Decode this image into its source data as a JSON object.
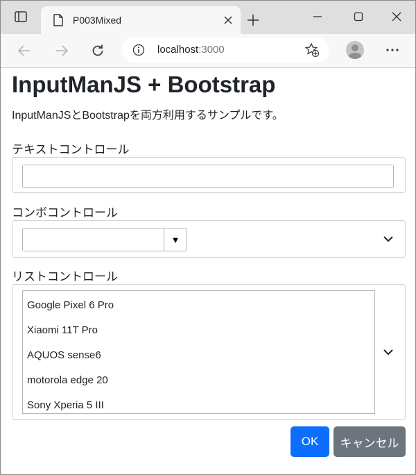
{
  "browser": {
    "tab_title": "P003Mixed",
    "url_host": "localhost",
    "url_port": ":3000"
  },
  "page": {
    "title": "InputManJS + Bootstrap",
    "description": "InputManJSとBootstrapを両方利用するサンプルです。",
    "text_control": {
      "label": "テキストコントロール",
      "value": ""
    },
    "combo_control": {
      "label": "コンボコントロール",
      "value": "",
      "dropdown_glyph": "▼"
    },
    "list_control": {
      "label": "リストコントロール",
      "items": [
        "Google Pixel 6 Pro",
        "Xiaomi 11T Pro",
        "AQUOS sense6",
        "motorola edge 20",
        "Sony Xperia 5 III"
      ]
    },
    "buttons": {
      "ok": "OK",
      "cancel": "キャンセル"
    }
  },
  "colors": {
    "primary": "#0d6efd",
    "secondary": "#6c757d",
    "border": "#ced4da"
  },
  "icons": [
    "sidebar-toggle-icon",
    "page-icon",
    "close-icon",
    "plus-icon",
    "minimize-icon",
    "maximize-icon",
    "back-icon",
    "forward-icon",
    "refresh-icon",
    "info-icon",
    "favorites-add-icon",
    "profile-icon",
    "more-icon",
    "chevron-down-icon"
  ]
}
